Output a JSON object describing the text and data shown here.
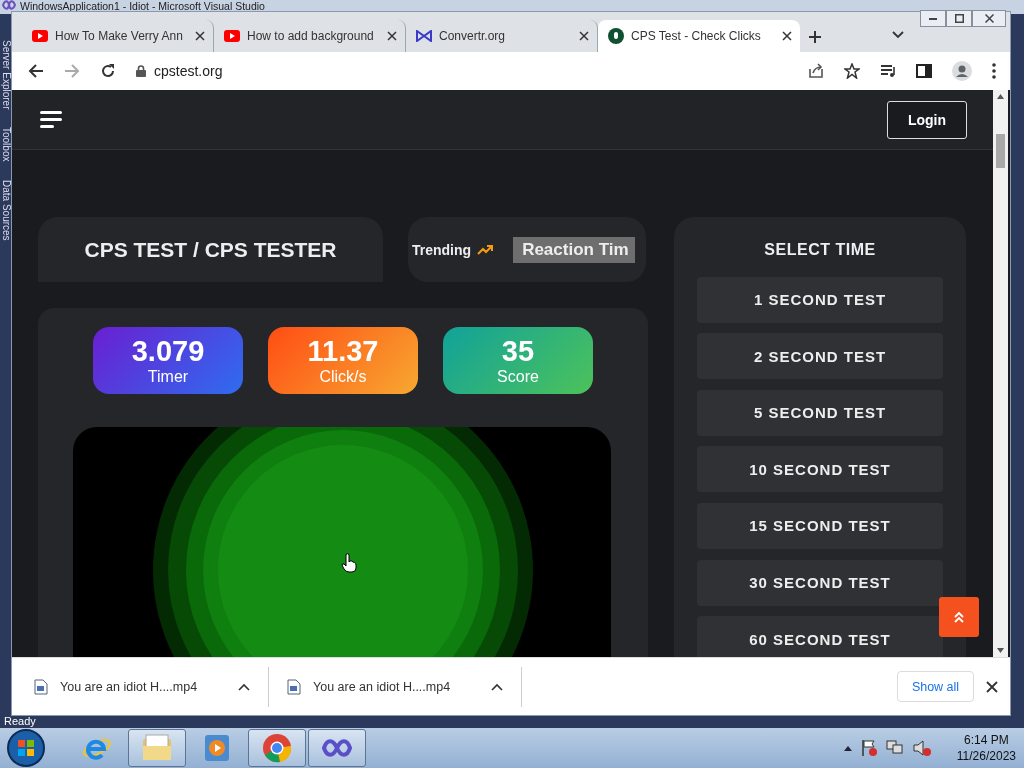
{
  "background_window": {
    "title": "WindowsApplication1 - Idiot - Microsoft Visual Studio",
    "side_tabs": [
      "Server Explorer",
      "Toolbox",
      "Data Sources"
    ],
    "status": "Ready"
  },
  "browser": {
    "tabs": [
      {
        "title": "How To Make Verry Ann",
        "kind": "youtube",
        "selected": false
      },
      {
        "title": "How to add background",
        "kind": "youtube",
        "selected": false
      },
      {
        "title": "Convertr.org",
        "kind": "convertr",
        "selected": false
      },
      {
        "title": "CPS Test - Check Clicks",
        "kind": "cps",
        "selected": true
      }
    ],
    "address": "cpstest.org"
  },
  "page": {
    "login": "Login",
    "title": "CPS TEST / CPS TESTER",
    "trending_label": "Trending",
    "trending_item": "Reaction Tim",
    "stats": [
      {
        "value": "3.079",
        "label": "Timer",
        "kind": "timer"
      },
      {
        "value": "11.37",
        "label": "Click/s",
        "kind": "clicks"
      },
      {
        "value": "35",
        "label": "Score",
        "kind": "score"
      }
    ],
    "select_time_title": "SELECT TIME",
    "time_options": [
      "1 SECOND TEST",
      "2 SECOND TEST",
      "5 SECOND TEST",
      "10 SECOND TEST",
      "15 SECOND TEST",
      "30 SECOND TEST",
      "60 SECOND TEST"
    ]
  },
  "downloads": {
    "items": [
      {
        "name": "You are an idiot H....mp4"
      },
      {
        "name": "You are an idiot H....mp4"
      }
    ],
    "show_all": "Show all"
  },
  "taskbar": {
    "apps": [
      {
        "kind": "ie",
        "open": false
      },
      {
        "kind": "explorer",
        "open": true
      },
      {
        "kind": "media",
        "open": false
      },
      {
        "kind": "chrome",
        "open": true
      },
      {
        "kind": "vs",
        "open": true
      }
    ],
    "time": "6:14 PM",
    "date": "11/26/2023"
  }
}
